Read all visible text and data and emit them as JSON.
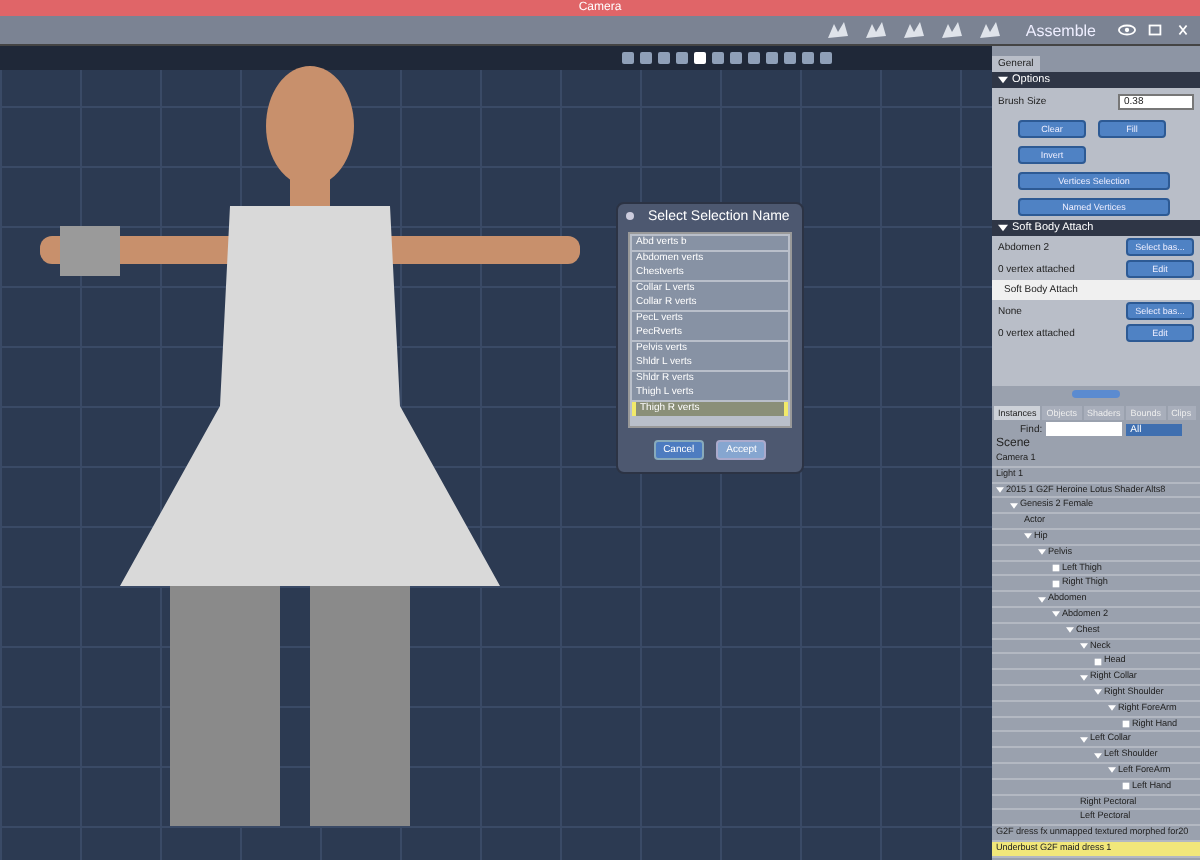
{
  "window": {
    "title": "Camera",
    "mode": "Assemble"
  },
  "dialog": {
    "title": "Select Selection Name",
    "items": [
      {
        "label": "Abd verts b",
        "selected": false
      },
      {
        "label": "Abdomen verts",
        "selected": false
      },
      {
        "label": "Chestverts",
        "selected": false
      },
      {
        "label": "Collar L verts",
        "selected": false
      },
      {
        "label": "Collar R verts",
        "selected": false
      },
      {
        "label": "PecL verts",
        "selected": false
      },
      {
        "label": "PecRverts",
        "selected": false
      },
      {
        "label": "Pelvis verts",
        "selected": false
      },
      {
        "label": "Shldr L verts",
        "selected": false
      },
      {
        "label": "Shldr R verts",
        "selected": false
      },
      {
        "label": "Thigh L verts",
        "selected": false
      },
      {
        "label": "Thigh R verts",
        "selected": true
      }
    ],
    "buttons": [
      {
        "label": "Cancel",
        "disabled": false
      },
      {
        "label": "Accept",
        "disabled": true
      }
    ]
  },
  "tool_panel": {
    "tabs": [
      {
        "label": "General",
        "selected": true
      }
    ],
    "options": {
      "title": "Options",
      "expanded": true,
      "brush_label": "Brush Size",
      "brush_value": "0.38",
      "buttons": [
        [
          "Clear",
          "Fill"
        ],
        [
          "Invert"
        ],
        [
          "Vertices Selection"
        ],
        [
          "Named Vertices"
        ]
      ]
    },
    "soft_body": {
      "title": "Soft Body Attach",
      "expanded": true,
      "rows": [
        {
          "kind": "item",
          "label": "Abdomen 2",
          "button": "Select bas..."
        },
        {
          "kind": "item",
          "label": "0 vertex attached",
          "button": "Edit"
        },
        {
          "kind": "header",
          "label": "Soft Body Attach"
        },
        {
          "kind": "item",
          "label": "None",
          "button": "Select bas..."
        },
        {
          "kind": "item",
          "label": "0 vertex attached",
          "button": "Edit"
        }
      ]
    }
  },
  "scene_panel": {
    "tabs": [
      {
        "label": "Instances",
        "selected": true
      },
      {
        "label": "Objects",
        "selected": false
      },
      {
        "label": "Shaders",
        "selected": false
      },
      {
        "label": "Bounds",
        "selected": false
      },
      {
        "label": "Clips",
        "selected": false
      }
    ],
    "find_label": "Find:",
    "filter": "All",
    "heading": "Scene",
    "tree": [
      {
        "label": "Camera 1",
        "selected": false
      },
      {
        "label": "Light 1",
        "selected": false
      },
      {
        "label": "2015 1 G2F Heroine Lotus Shader Alts8",
        "selected": false,
        "expanded": true,
        "children": [
          {
            "label": "Genesis 2 Female",
            "selected": false,
            "expanded": true,
            "children": [
              {
                "label": "Actor",
                "selected": false
              },
              {
                "label": "Hip",
                "selected": false,
                "expanded": true,
                "children": [
                  {
                    "label": "Pelvis",
                    "selected": false,
                    "expanded": true,
                    "children": [
                      {
                        "label": "Left Thigh",
                        "selected": false,
                        "expanded": false
                      },
                      {
                        "label": "Right Thigh",
                        "selected": false,
                        "expanded": false
                      }
                    ]
                  },
                  {
                    "label": "Abdomen",
                    "selected": false,
                    "expanded": true,
                    "children": [
                      {
                        "label": "Abdomen 2",
                        "selected": false,
                        "expanded": true,
                        "children": [
                          {
                            "label": "Chest",
                            "selected": false,
                            "expanded": true,
                            "children": [
                              {
                                "label": "Neck",
                                "selected": false,
                                "expanded": true,
                                "children": [
                                  {
                                    "label": "Head",
                                    "selected": false,
                                    "expanded": false
                                  }
                                ]
                              },
                              {
                                "label": "Right Collar",
                                "selected": false,
                                "expanded": true,
                                "children": [
                                  {
                                    "label": "Right Shoulder",
                                    "selected": false,
                                    "expanded": true,
                                    "children": [
                                      {
                                        "label": "Right ForeArm",
                                        "selected": false,
                                        "expanded": true,
                                        "children": [
                                          {
                                            "label": "Right Hand",
                                            "selected": false,
                                            "expanded": false
                                          }
                                        ]
                                      }
                                    ]
                                  }
                                ]
                              },
                              {
                                "label": "Left Collar",
                                "selected": false,
                                "expanded": true,
                                "children": [
                                  {
                                    "label": "Left Shoulder",
                                    "selected": false,
                                    "expanded": true,
                                    "children": [
                                      {
                                        "label": "Left ForeArm",
                                        "selected": false,
                                        "expanded": true,
                                        "children": [
                                          {
                                            "label": "Left Hand",
                                            "selected": false,
                                            "expanded": false
                                          }
                                        ]
                                      }
                                    ]
                                  }
                                ]
                              },
                              {
                                "label": "Right Pectoral",
                                "selected": false
                              },
                              {
                                "label": "Left Pectoral",
                                "selected": false
                              }
                            ]
                          }
                        ]
                      }
                    ]
                  }
                ]
              }
            ]
          }
        ]
      },
      {
        "label": "G2F dress fx unmapped textured morphed for20",
        "selected": false
      },
      {
        "label": "Underbust G2F maid dress 1",
        "selected": true
      }
    ]
  }
}
